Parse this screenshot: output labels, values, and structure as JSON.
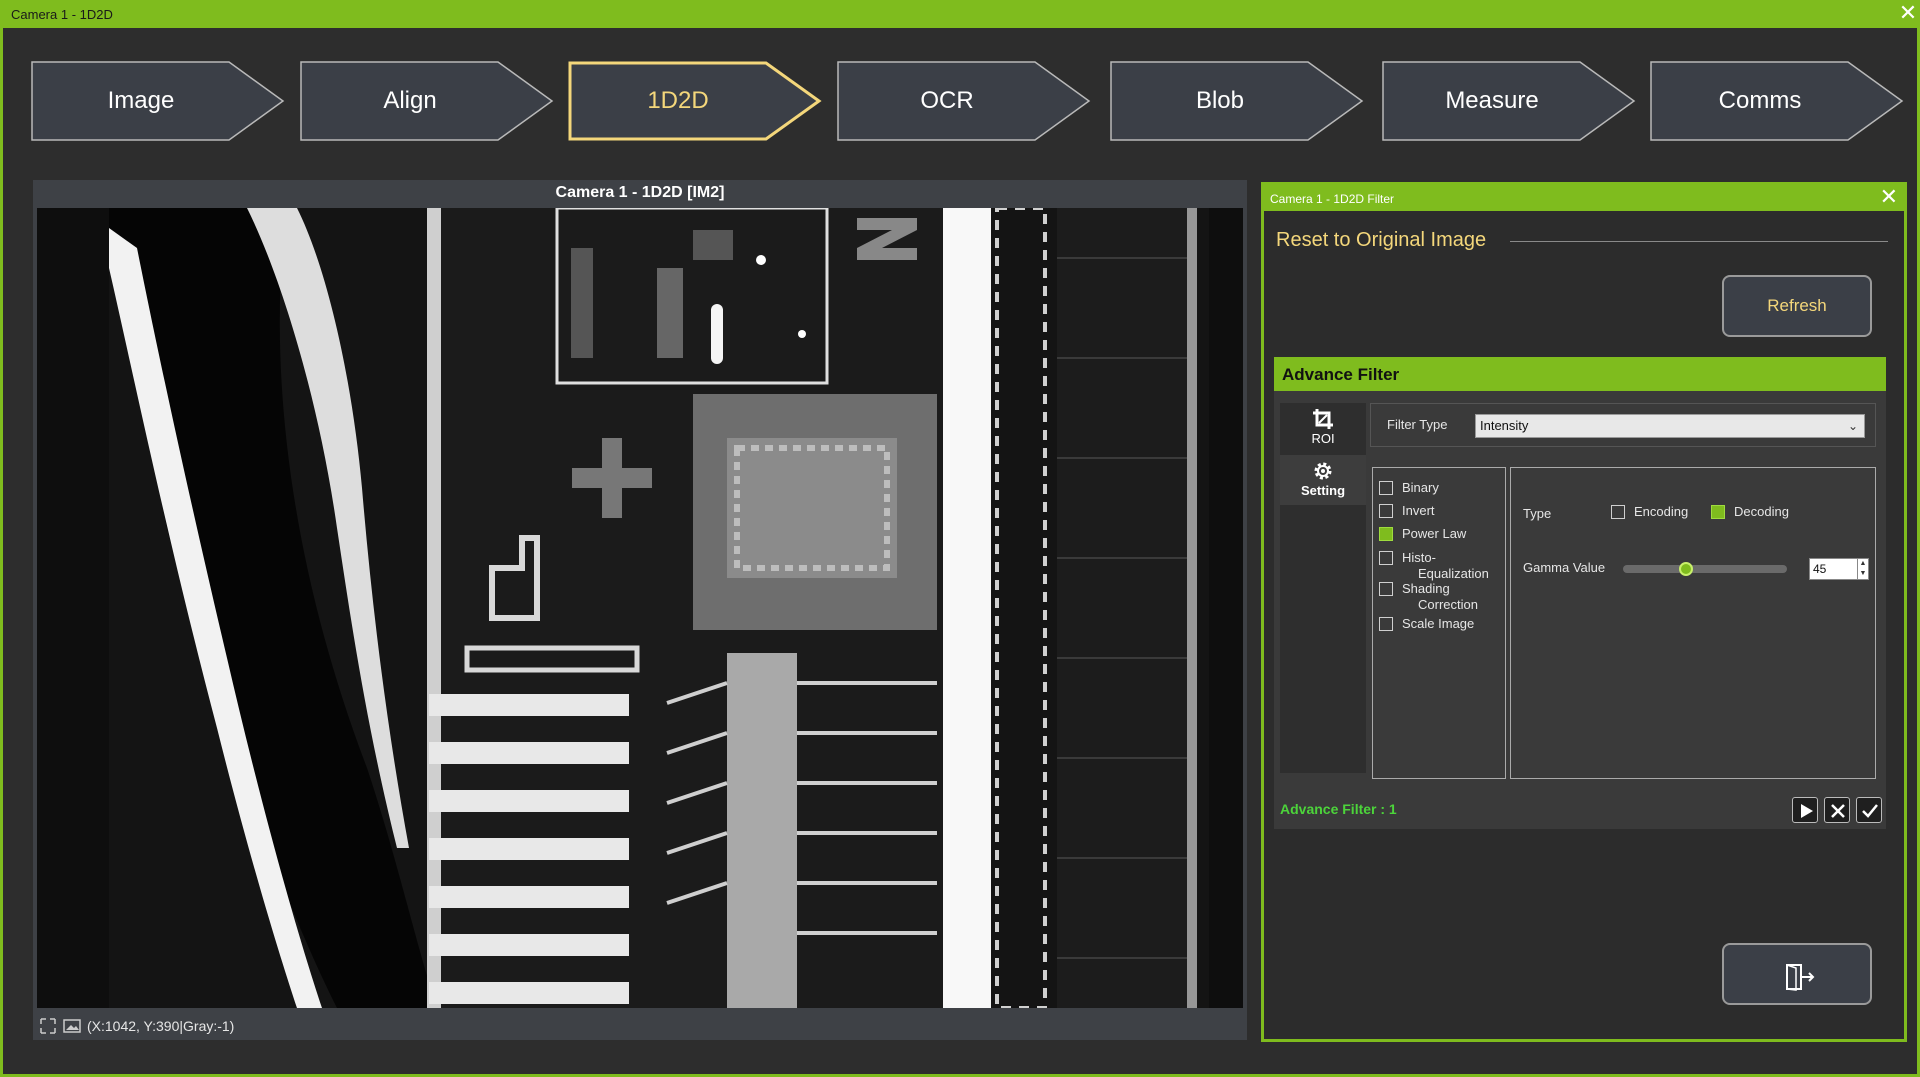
{
  "window": {
    "title": "Camera 1 - 1D2D",
    "close_glyph": "✕"
  },
  "steps": [
    {
      "label": "Image",
      "active": false
    },
    {
      "label": "Align",
      "active": false
    },
    {
      "label": "1D2D",
      "active": true
    },
    {
      "label": "OCR",
      "active": false
    },
    {
      "label": "Blob",
      "active": false
    },
    {
      "label": "Measure",
      "active": false
    },
    {
      "label": "Comms",
      "active": false
    }
  ],
  "viewer": {
    "title": "Camera 1 - 1D2D  [IM2]",
    "status": "(X:1042, Y:390|Gray:-1)",
    "icons": [
      "fit-to-window-icon",
      "image-icon"
    ]
  },
  "filter_panel": {
    "title": "Camera 1 - 1D2D Filter",
    "close_glyph": "✕",
    "reset_title": "Reset to Original Image",
    "refresh_label": "Refresh",
    "advance_filter": {
      "header": "Advance Filter",
      "tabs": [
        {
          "label": "ROI",
          "icon": "crop-icon",
          "active": false
        },
        {
          "label": "Setting",
          "icon": "gear-icon",
          "active": true
        }
      ],
      "filter_type_label": "Filter Type",
      "filter_type_value": "Intensity",
      "options": [
        {
          "label": "Binary",
          "checked": false
        },
        {
          "label": "Invert",
          "checked": false
        },
        {
          "label": "Power Law",
          "checked": true
        },
        {
          "label": "Histo-\nEqualization",
          "label_line1": "Histo-",
          "label_line2": "Equalization",
          "checked": false
        },
        {
          "label_line1": "Shading",
          "label_line2": "Correction",
          "checked": false
        },
        {
          "label": "Scale Image",
          "checked": false
        }
      ],
      "type_label": "Type",
      "type_options": [
        {
          "label": "Encoding",
          "checked": false
        },
        {
          "label": "Decoding",
          "checked": true
        }
      ],
      "gamma_label": "Gamma Value",
      "gamma_value": "45",
      "gamma_slider_fraction": 0.37,
      "status": "Advance Filter : 1",
      "buttons": [
        "play-icon",
        "close-icon",
        "check-icon"
      ]
    },
    "exit_icon": "exit-door-icon"
  },
  "colors": {
    "accent": "#7fbc1e",
    "active_text": "#f4d77b",
    "status_green": "#4cd43a",
    "button_fill": "#3b3f47"
  }
}
